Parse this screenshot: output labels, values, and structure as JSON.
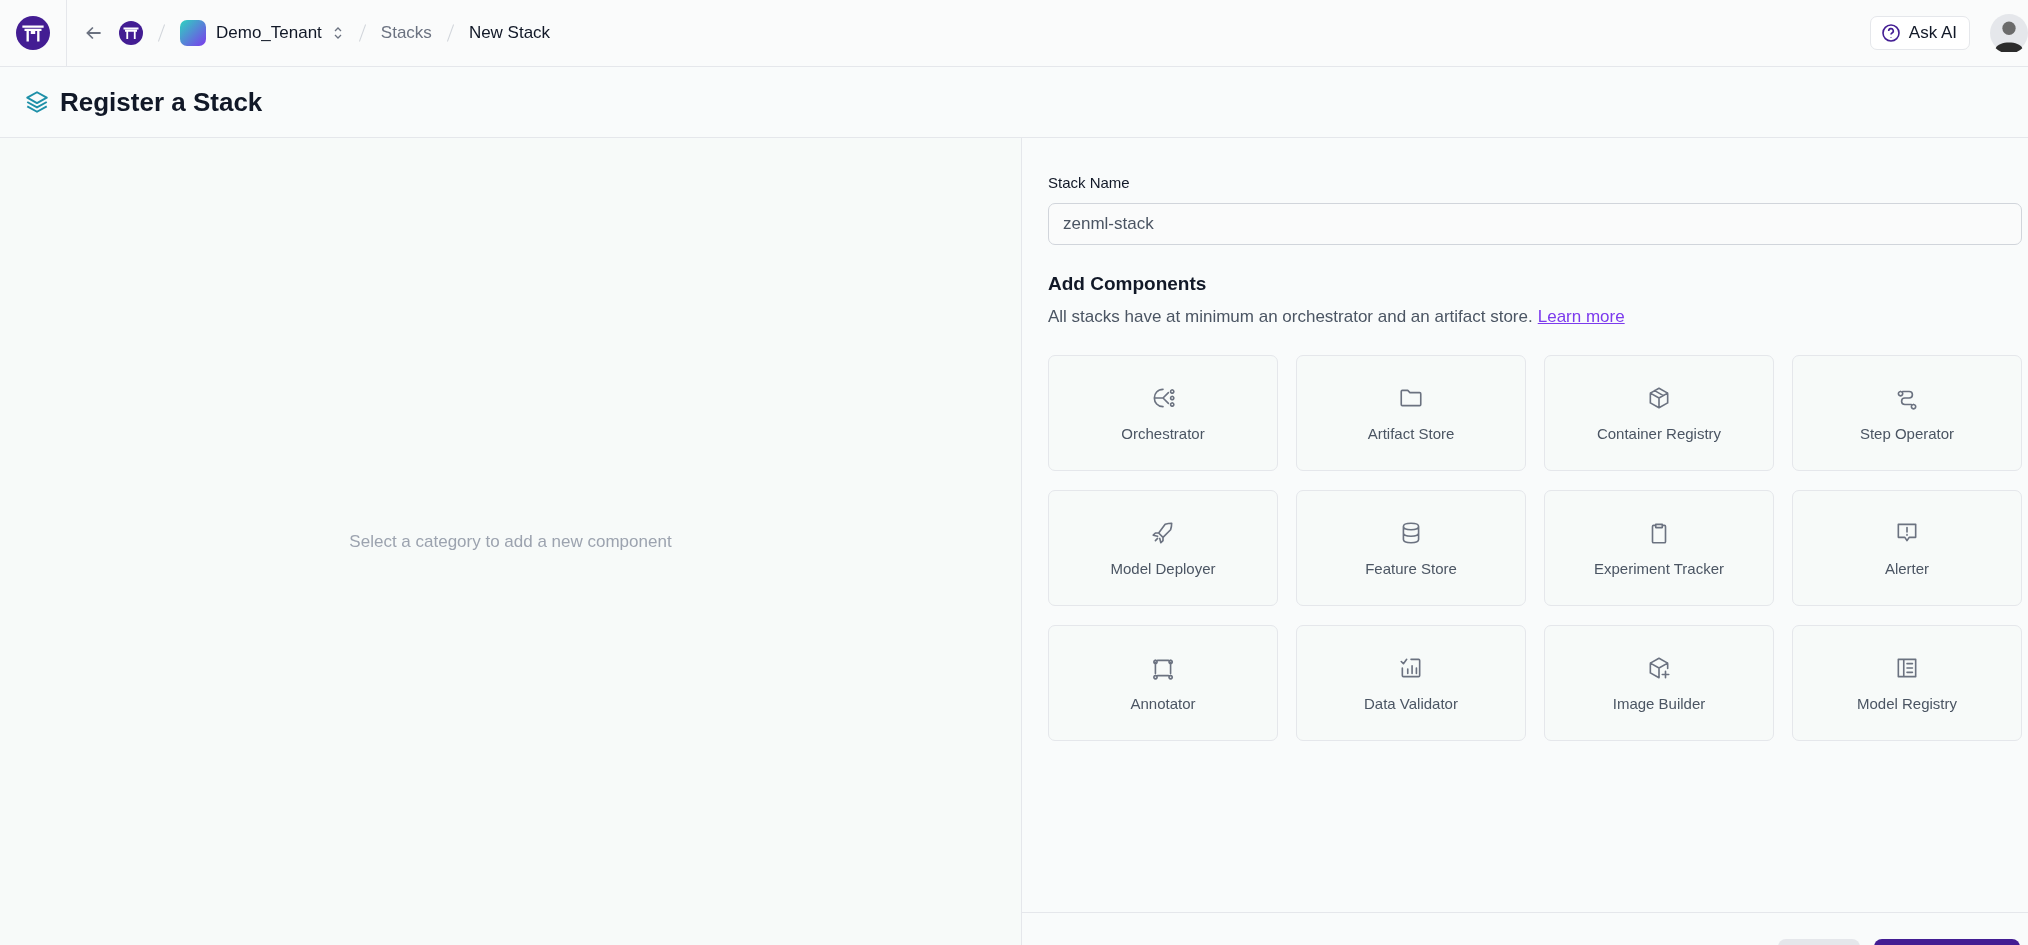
{
  "topbar": {
    "breadcrumbs": [
      {
        "kind": "tenant",
        "label": "Demo_Tenant"
      },
      {
        "kind": "link",
        "label": "Stacks"
      },
      {
        "kind": "current",
        "label": "New Stack"
      }
    ],
    "ask_ai": "Ask AI"
  },
  "header": {
    "title": "Register a Stack"
  },
  "left_panel": {
    "empty_message": "Select a category to add a new component"
  },
  "form": {
    "label": "Stack Name",
    "value": "zenml-stack"
  },
  "components": {
    "title": "Add Components",
    "description": "All stacks have at minimum an orchestrator and an artifact store.",
    "link": "Learn more",
    "items": [
      {
        "label": "Orchestrator"
      },
      {
        "label": "Artifact Store"
      },
      {
        "label": "Container Registry"
      },
      {
        "label": "Step Operator"
      },
      {
        "label": "Model Deployer"
      },
      {
        "label": "Feature Store"
      },
      {
        "label": "Experiment Tracker"
      },
      {
        "label": "Alerter"
      },
      {
        "label": "Annotator"
      },
      {
        "label": "Data Validator"
      },
      {
        "label": "Image Builder"
      },
      {
        "label": "Model Registry"
      }
    ]
  },
  "footer": {
    "buttons": [
      {
        "kind": "secondary"
      },
      {
        "kind": "primary"
      }
    ]
  }
}
